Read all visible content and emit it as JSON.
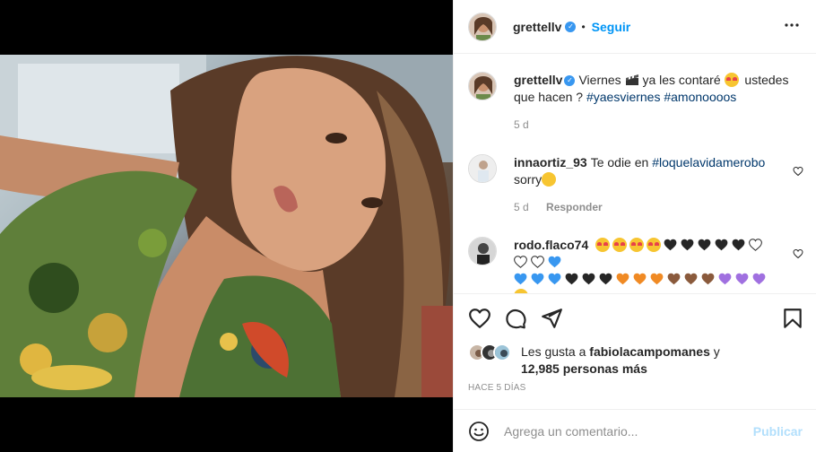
{
  "header": {
    "username": "grettellv",
    "verified_mark": "✓",
    "separator": "•",
    "follow_label": "Seguir",
    "more_label": "•••"
  },
  "caption": {
    "username": "grettellv",
    "text_before": "Viernes",
    "text_after_icons": "ya les contaré",
    "text_tail": "ustedes que hacen ?",
    "hashtags": [
      "#yaesviernes",
      "#amonoooos"
    ],
    "time": "5 d"
  },
  "comments": [
    {
      "username": "innaortiz_93",
      "text_before": "Te odie en",
      "hashtag": "#loquelavidamerobo",
      "text_after": "sorry",
      "time": "5 d",
      "reply_label": "Responder"
    },
    {
      "username": "rodo.flaco74",
      "heart_colors_row1": [
        "#262626",
        "#262626",
        "#262626",
        "#262626",
        "#262626",
        "#ffffff",
        "#ffffff",
        "#ffffff",
        "#3897f0"
      ],
      "heart_colors_row2": [
        "#3897f0",
        "#3897f0",
        "#3897f0",
        "#262626",
        "#262626",
        "#262626",
        "#f08a24",
        "#f08a24",
        "#f08a24",
        "#8a5a3c",
        "#8a5a3c",
        "#8a5a3c",
        "#a070e0",
        "#a070e0",
        "#a070e0"
      ],
      "heart_colors_row3": [
        "#e8414a",
        "#e8414a",
        "#e8414a",
        "#e8414a",
        "#58c322",
        "#58c322",
        "#f5d000",
        "#f5d000",
        "#e8414a",
        "#e8414a",
        "#e8414a",
        "#e8414a"
      ]
    }
  ],
  "likes": {
    "prefix": "Les gusta a",
    "user": "fabiolacampomanes",
    "conj": "y",
    "count_text": "12,985 personas más"
  },
  "time_ago": "HACE 5 DÍAS",
  "add_comment": {
    "placeholder": "Agrega un comentario...",
    "post_label": "Publicar"
  },
  "icons": {
    "like": "heart-icon",
    "comment": "comment-icon",
    "share": "paper-plane-icon",
    "save": "bookmark-icon",
    "emoji": "emoji-icon",
    "more": "more-options-icon"
  },
  "colors": {
    "accent": "#0095f6",
    "verified": "#3897f0",
    "hashtag": "#00376b",
    "muted": "#8e8e8e",
    "post_disabled": "#b2dffc"
  }
}
